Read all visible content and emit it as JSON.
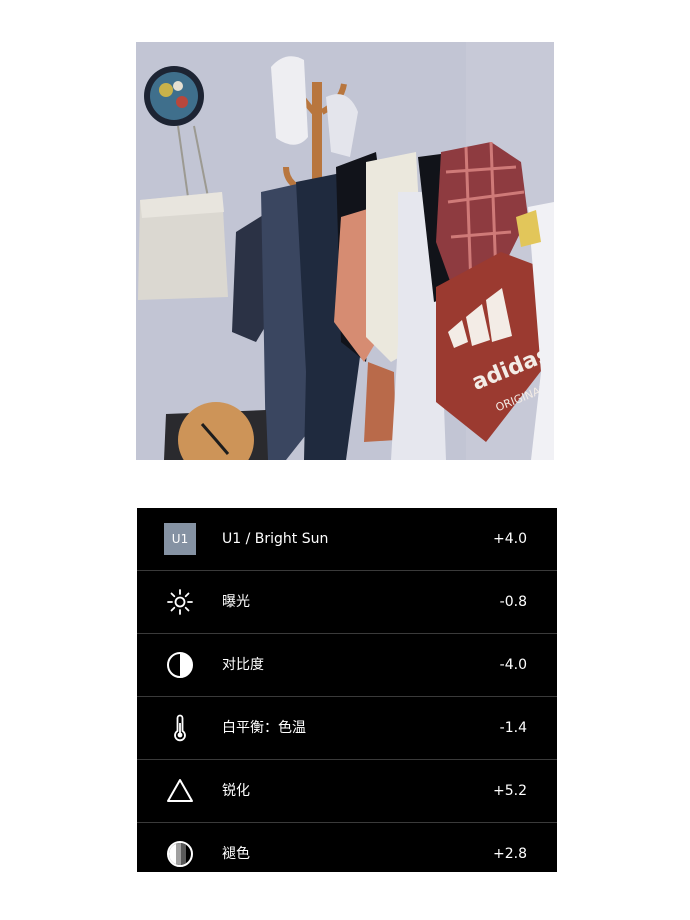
{
  "photo": {
    "brand_text": "adidas",
    "sub_text": "ORIGINALS"
  },
  "adjustments": [
    {
      "icon": "preset-badge-icon",
      "badge": "U1",
      "label": "U1 / Bright Sun",
      "value": "+4.0"
    },
    {
      "icon": "exposure-icon",
      "label": "曝光",
      "value": "-0.8"
    },
    {
      "icon": "contrast-icon",
      "label": "对比度",
      "value": "-4.0"
    },
    {
      "icon": "thermometer-icon",
      "label": "白平衡：色温",
      "value": "-1.4"
    },
    {
      "icon": "sharpen-icon",
      "label": "锐化",
      "value": "+5.2"
    },
    {
      "icon": "fade-icon",
      "label": "褪色",
      "value": "+2.8"
    }
  ],
  "colors": {
    "panel_bg": "#000000",
    "badge_bg": "#8592a3",
    "divider": "#3a3a3a",
    "bag_red": "#9b3a30"
  }
}
